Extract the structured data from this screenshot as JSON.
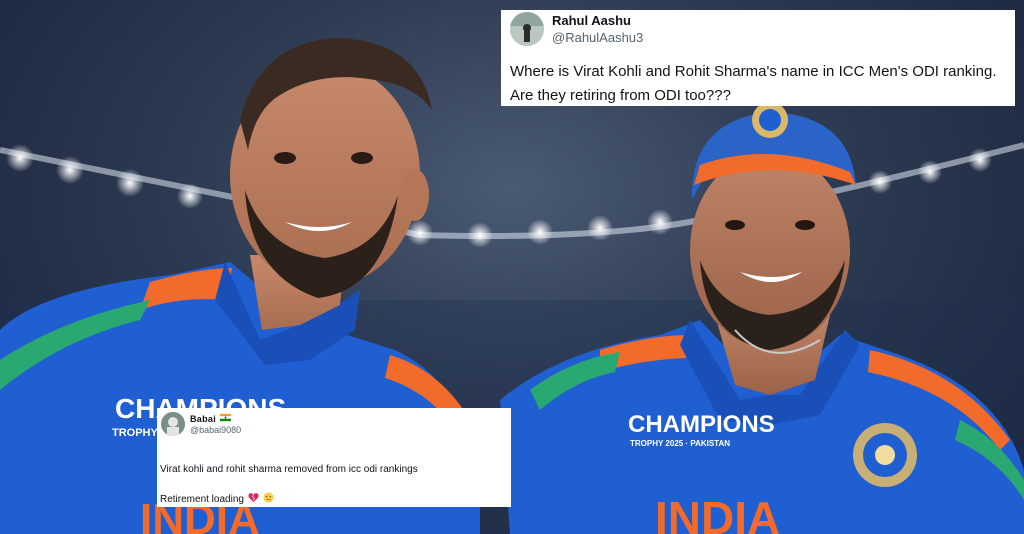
{
  "photo": {
    "jersey_left_text": "CHAMPIONS",
    "jersey_left_sub": "TROPHY",
    "jersey_right_text": "CHAMPIONS",
    "jersey_right_sub": "TROPHY 2025 · PAKISTAN",
    "jersey_chest_text": "INDIA",
    "colors": {
      "jersey_blue": "#1f5fd1",
      "jersey_orange": "#f26b2a",
      "jersey_green": "#2aa872",
      "cap_blue": "#2a64c9"
    }
  },
  "tweet_main": {
    "author_name": "Rahul Aashu",
    "author_handle": "@RahulAashu3",
    "text": "Where is Virat Kohli and Rohit Sharma's name in ICC Men's ODI ranking. Are they retiring from ODI too???"
  },
  "tweet_small": {
    "author_name": "Babai",
    "author_handle": "@babai9080",
    "text_line1": "Virat kohli and rohit sharma removed from icc odi rankings",
    "text_line2": "Retirement loading",
    "icons": [
      "india-flag-icon",
      "broken-heart-icon",
      "sad-face-icon"
    ]
  }
}
